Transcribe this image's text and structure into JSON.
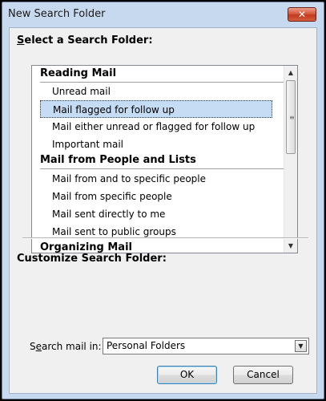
{
  "window": {
    "title": "New Search Folder",
    "close_glyph": "✕"
  },
  "select_section": {
    "heading_prefix": "S",
    "heading_rest": "elect a Search Folder:"
  },
  "list": {
    "groups": [
      {
        "label": "Reading Mail"
      },
      {
        "label": "Mail from People and Lists"
      },
      {
        "label": "Organizing Mail"
      }
    ],
    "items": [
      {
        "label": "Unread mail"
      },
      {
        "label": "Mail flagged for follow up",
        "selected": true
      },
      {
        "label": "Mail either unread or flagged for follow up"
      },
      {
        "label": "Important mail"
      },
      {
        "label": "Mail from and to specific people"
      },
      {
        "label": "Mail from specific people"
      },
      {
        "label": "Mail sent directly to me"
      },
      {
        "label": "Mail sent to public groups"
      }
    ],
    "scroll_up_glyph": "▲",
    "scroll_down_glyph": "▼",
    "grip_glyph": "≡"
  },
  "customize_section": {
    "heading": "Customize Search Folder:"
  },
  "search_in": {
    "label_prefix": "S",
    "label_underlined": "e",
    "label_rest": "arch mail in:",
    "value": "Personal Folders",
    "dropdown_glyph": "▼"
  },
  "buttons": {
    "ok": "OK",
    "cancel": "Cancel"
  },
  "colors": {
    "frame": "#c7d9ee",
    "selection": "#c5dcf4",
    "close_button": "#c33a1d"
  }
}
